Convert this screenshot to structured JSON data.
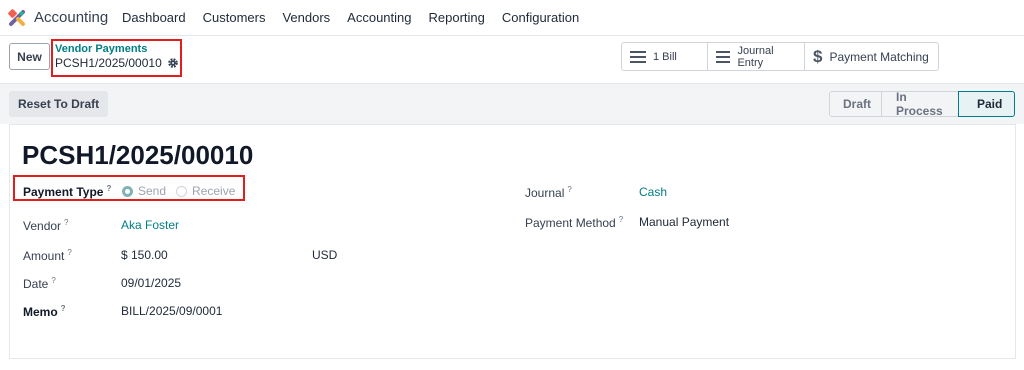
{
  "nav": {
    "app_name": "Accounting",
    "menu": [
      "Dashboard",
      "Customers",
      "Vendors",
      "Accounting",
      "Reporting",
      "Configuration"
    ]
  },
  "control": {
    "new_label": "New",
    "breadcrumb": "Vendor Payments",
    "record_name": "PCSH1/2025/00010",
    "smart_buttons": [
      {
        "icon": "list-icon",
        "label": "1 Bill"
      },
      {
        "icon": "list-icon",
        "label": "Journal Entry"
      },
      {
        "icon": "dollar-icon",
        "label": "Payment Matching"
      }
    ]
  },
  "status": {
    "reset_label": "Reset To Draft",
    "stages": [
      "Draft",
      "In Process",
      "Paid"
    ],
    "current": "Paid"
  },
  "form": {
    "title": "PCSH1/2025/00010",
    "payment_type": {
      "label": "Payment Type",
      "options": [
        "Send",
        "Receive"
      ],
      "selected": "Send"
    },
    "vendor": {
      "label": "Vendor",
      "value": "Aka Foster"
    },
    "amount": {
      "label": "Amount",
      "value": "$ 150.00",
      "currency": "USD"
    },
    "date": {
      "label": "Date",
      "value": "09/01/2025"
    },
    "memo": {
      "label": "Memo",
      "value": "BILL/2025/09/0001"
    },
    "journal": {
      "label": "Journal",
      "value": "Cash"
    },
    "payment_method": {
      "label": "Payment Method",
      "value": "Manual Payment"
    },
    "help_mark": "?"
  },
  "colors": {
    "accent": "#017e84",
    "highlight": "#e11d1d",
    "brand": "#71639e"
  }
}
